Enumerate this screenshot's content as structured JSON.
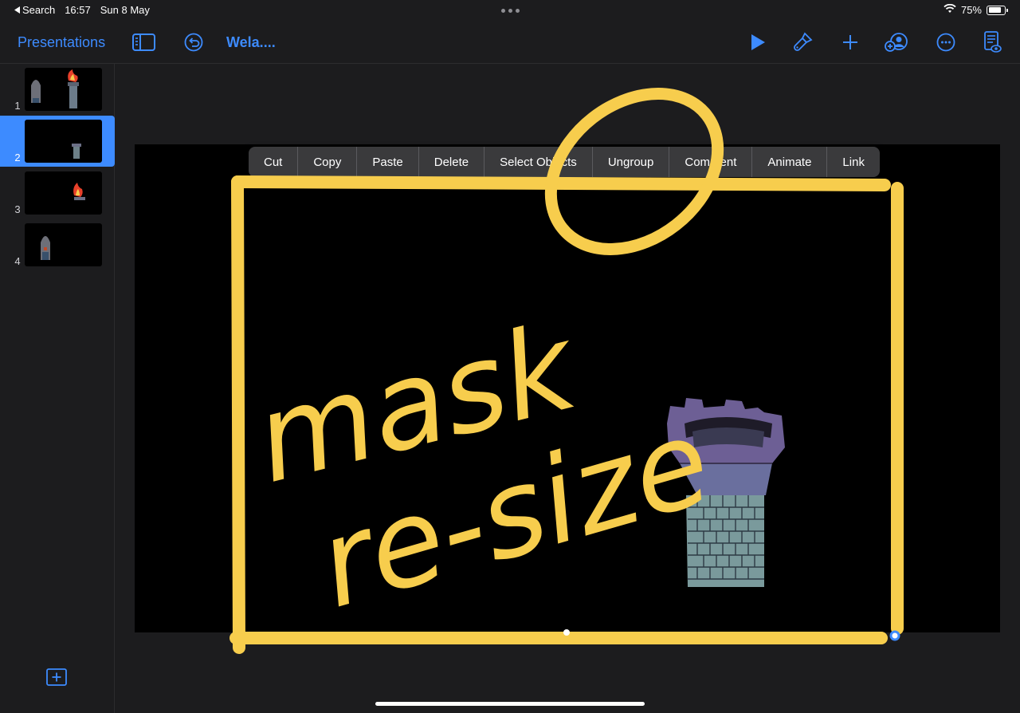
{
  "status_bar": {
    "back_label": "Search",
    "time": "16:57",
    "date": "Sun 8 May",
    "battery": "75%"
  },
  "toolbar": {
    "presentations_label": "Presentations",
    "document_title": "Wela...."
  },
  "slides": [
    {
      "number": "1"
    },
    {
      "number": "2"
    },
    {
      "number": "3"
    },
    {
      "number": "4"
    }
  ],
  "selected_slide": 2,
  "context_menu": {
    "items": [
      "Cut",
      "Copy",
      "Paste",
      "Delete",
      "Select Objects",
      "Ungroup",
      "Comment",
      "Animate",
      "Link"
    ]
  },
  "annotation": {
    "line1": "mask",
    "line2": "re-size",
    "color": "#f7cd4d"
  },
  "colors": {
    "accent": "#3d8bff",
    "background": "#1c1c1e",
    "slide": "#000000"
  }
}
